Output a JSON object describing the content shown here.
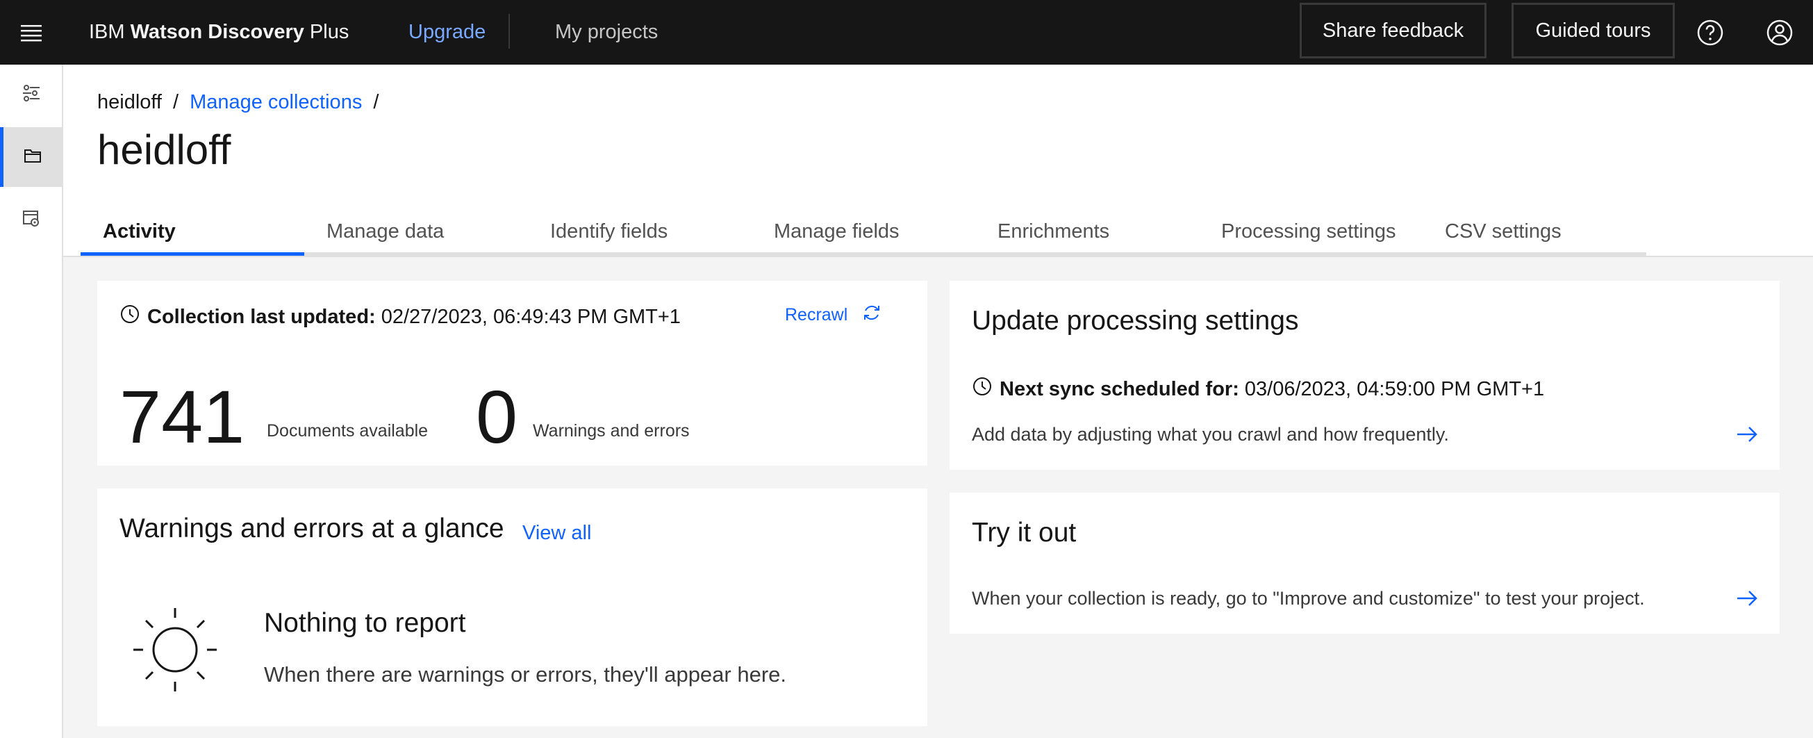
{
  "header": {
    "brand_prefix": "IBM",
    "brand_name": "Watson Discovery",
    "brand_suffix": "Plus",
    "upgrade_label": "Upgrade",
    "my_projects_label": "My projects",
    "share_feedback_label": "Share feedback",
    "guided_tours_label": "Guided tours"
  },
  "breadcrumb": {
    "items": [
      "heidloff",
      "Manage collections"
    ],
    "separator": "/"
  },
  "page_title": "heidloff",
  "tabs": [
    "Activity",
    "Manage data",
    "Identify fields",
    "Manage fields",
    "Enrichments",
    "Processing settings",
    "CSV settings"
  ],
  "activity_card": {
    "updated_label": "Collection last updated:",
    "updated_value": "02/27/2023, 06:49:43 PM GMT+1",
    "recrawl_label": "Recrawl",
    "documents_count": "741",
    "documents_label": "Documents available",
    "warnings_count": "0",
    "warnings_label": "Warnings and errors"
  },
  "warnings_card": {
    "title": "Warnings and errors at a glance",
    "view_all_label": "View all",
    "empty_title": "Nothing to report",
    "empty_desc": "When there are warnings or errors, they'll appear here."
  },
  "processing_card": {
    "title": "Update processing settings",
    "sync_label": "Next sync scheduled for:",
    "sync_value": "03/06/2023, 04:59:00 PM GMT+1",
    "description": "Add data by adjusting what you crawl and how frequently."
  },
  "tryit_card": {
    "title": "Try it out",
    "description": "When your collection is ready, go to \"Improve and customize\" to test your project."
  },
  "colors": {
    "accent": "#0f62fe",
    "header_bg": "#161616",
    "upgrade_link": "#78a9ff"
  }
}
